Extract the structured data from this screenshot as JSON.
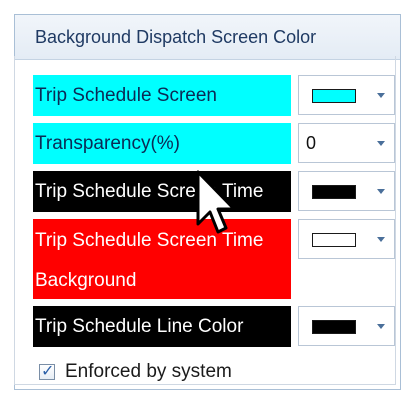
{
  "panel": {
    "title": "Background Dispatch Screen Color"
  },
  "rows": [
    {
      "label": "Trip Schedule Screen",
      "label_bg": "#00ffff",
      "label_fg": "#0b2a55",
      "combo_type": "color",
      "color_value": "#00ffff"
    },
    {
      "label": "Transparency(%)",
      "label_bg": "#00ffff",
      "label_fg": "#0b2a55",
      "combo_type": "number",
      "value": "0"
    },
    {
      "label": "Trip Schedule Screen Time",
      "label_bg": "#000000",
      "label_fg": "#ffffff",
      "combo_type": "color",
      "color_value": "#000000"
    },
    {
      "label_line1": "Trip Schedule Screen Time",
      "label_line2": "Background",
      "label_bg": "#ff0000",
      "label_fg": "#ffffff",
      "combo_type": "color",
      "color_value": "#ffffff"
    },
    {
      "label": "Trip Schedule Line Color",
      "label_bg": "#000000",
      "label_fg": "#ffffff",
      "combo_type": "color",
      "color_value": "#000000"
    }
  ],
  "checkbox": {
    "label": "Enforced by system",
    "checked": true
  },
  "icons": {
    "checkmark": "✓",
    "dropdown": "chevron-down-icon",
    "cursor": "mouse-pointer-icon"
  }
}
